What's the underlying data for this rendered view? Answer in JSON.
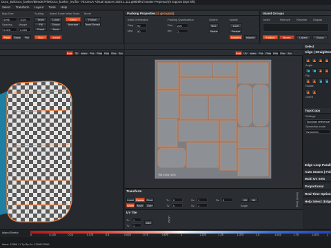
{
  "window": {
    "title": "Doco_B2/Doco_bunker/Blender/File/Doco_bunker_inv.fbx - RizomUV  Virtual Spaces 2020.1.111.g89b5fed master Perpetual  (0 support days left)"
  },
  "menu": [
    "Select",
    "Transform",
    "Layout",
    "Tools",
    "Help"
  ],
  "colors": {
    "accent": "#e4572e",
    "selection_edge": "#ff7a2e",
    "panel": "#2a2e33",
    "viewport_bg": "#26292d",
    "seam_blue": "#2fb3d6"
  },
  "toolbar": {
    "map_size_label": "Map Size",
    "map_size_value": "4096",
    "map_size_value2": "1024",
    "scaling_label": "Scaling",
    "texel_label": "Texel",
    "fill_label": "Fill",
    "island_scale_label": "Island Scale",
    "fixed_label": "Fixed",
    "keep_label": "Keep",
    "average_label": "Average",
    "group_label": "Group",
    "sync_label": "Sync",
    "local_label": "Local",
    "spacing_label": "Spacing",
    "margin_label": "Margin",
    "initial_scale_label": "Initial Scale",
    "follow_label": "Follow",
    "texel_density_label": "Texel Density",
    "mode_label": "Mode",
    "setting_label": "Setting",
    "packing_label": "Packing",
    "fill_v": "0.025",
    "margin_v": "0.025",
    "pack_label": "Pack",
    "run_label": "Run",
    "unfold_label": "Unfold",
    "stack_label": "Stack",
    "flip_label": "Flip"
  },
  "packing": {
    "title_prefix": "Packing Properties",
    "title_suffix": "(1 group(s))",
    "initial_orientation_label": "Initial Orientation",
    "packing_quality_label": "Packing Quantization",
    "step_label": "Step",
    "step_value": "90",
    "max_label": "Max",
    "max_value": "90",
    "res_label": "Res.",
    "res_value": "200",
    "iter_label": "Iter.",
    "iter_value": "1",
    "outline_label": "Outline",
    "packing_label": "Packing",
    "isolate_label": "Isolate",
    "shape_label": "Shape",
    "box_label": "Box",
    "freeze_label": "Freeze",
    "lock_label": "Lock",
    "handles_label": "Handles",
    "islands_label": "Islands",
    "texel_label": "Texel"
  },
  "island_groups": {
    "title": "Island Groups",
    "col1": "Index",
    "col2": "Remove",
    "col3": "Rename",
    "col4": "Display",
    "btn1": "Fullbox",
    "btn2": "Boxes",
    "btn3": "Labels",
    "btn4": "Group"
  },
  "viewport3d": {
    "tabs": [
      "Shaders",
      "Lights",
      "Handles",
      "Isolate",
      "Islands",
      "Grids",
      "Texel"
    ],
    "tools": [
      "Both",
      "3D",
      "Islands",
      "Poly",
      "Flats",
      "Hide",
      "Show",
      "Box"
    ]
  },
  "viewportuv": {
    "tabs": [
      "Shaders",
      "Lights",
      "Handles",
      "Isolate",
      "Islands",
      "Grids",
      "Texel"
    ],
    "tools": [
      "Both",
      "UV",
      "Islands",
      "Poly",
      "Flats",
      "Hide",
      "Show",
      "Box"
    ],
    "tile_label": "Tile 1001 (UV)"
  },
  "transform": {
    "title": "Transform",
    "local_label": "Local",
    "center_label": "Center",
    "pivot_label": "Pivot",
    "world_label": "World",
    "multi_label": "Multi",
    "user_label": "User",
    "tu_label": "Tu",
    "tv_label": "Tv",
    "su_label": "Su",
    "sv_label": "Sv",
    "ro_label": "Ro",
    "zero": "0",
    "one": "1",
    "ninety": "90",
    "neg_ninety": "-90",
    "angle_label": "Angle",
    "grid_snap_label": "Grid & Snap"
  },
  "uvtile": {
    "title": "UV Tile",
    "tu_label": "Tu",
    "tv_label": "Tv",
    "tu_value": "1",
    "tv_value": "1",
    "add_label": "Add",
    "udim_label": "UDIM"
  },
  "right_panel": {
    "select_label": "Select",
    "align_label": "Align | Straighten",
    "angle_label": "Angle",
    "flip_label": "Flip",
    "rotate_label": "Rotate",
    "orient_label": "Orient",
    "topocopy_label": "TopoCopy",
    "settings_label": "Settings",
    "topology_ref": "Topology reference",
    "symmetry_label": "Symmetry mode",
    "symmetry_mode": "Symmetry",
    "edge_loop": "Edge Loop Parallelize",
    "auto_seams": "Auto Seams | Fold",
    "multi_uv": "Multi UV Sets",
    "proportional": "Proportional",
    "real_time": "Real Time Options",
    "help_select": "Help Select (Edges)"
  },
  "status": {
    "island_stretch_label": "Island Stretch",
    "scale_ticks": [
      "0",
      "0.125",
      "0.25",
      "0.375",
      "0.5",
      "0.625",
      "0.75",
      "0.875",
      "1",
      "1.125",
      "1.25",
      "1.375",
      "1.5",
      "1.625",
      "1.75",
      "1.875",
      "2"
    ],
    "stats": "Items: 12969 / 1 Tp Rp Uv: 12969/12969"
  }
}
